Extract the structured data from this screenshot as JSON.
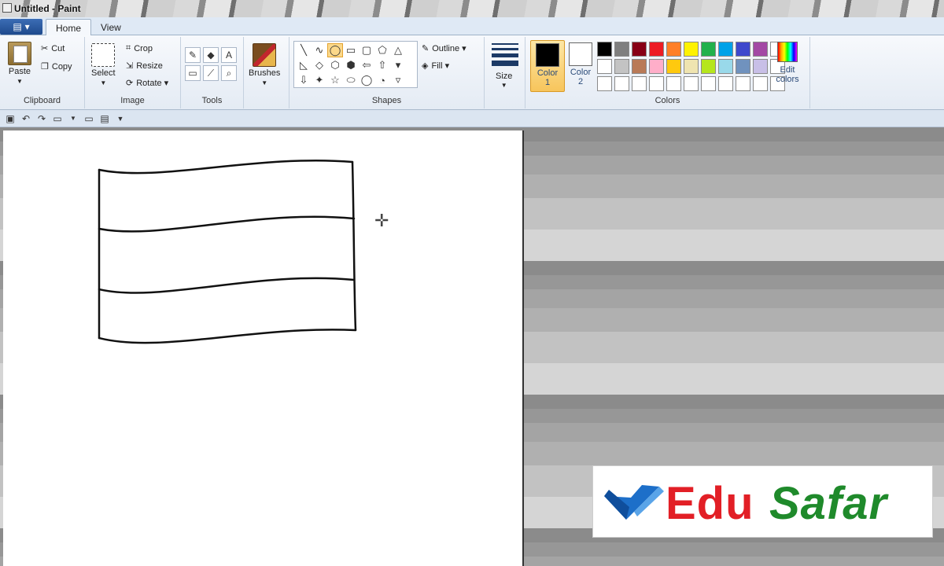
{
  "window": {
    "title": "Untitled - Paint"
  },
  "tabs": {
    "file_label": "▾",
    "home": "Home",
    "view": "View"
  },
  "clipboard": {
    "paste": "Paste",
    "cut": "Cut",
    "copy": "Copy",
    "group": "Clipboard"
  },
  "image": {
    "select": "Select",
    "crop": "Crop",
    "resize": "Resize",
    "rotate": "Rotate ▾",
    "group": "Image"
  },
  "tools": {
    "group": "Tools",
    "items": [
      "✎",
      "◆",
      "A",
      "▭",
      "⟋",
      "⌕"
    ]
  },
  "brushes": {
    "label": "Brushes"
  },
  "shapes": {
    "group": "Shapes",
    "outline": "Outline ▾",
    "fill": "Fill ▾",
    "items": [
      "╲",
      "∿",
      "◯",
      "▭",
      "▢",
      "⬠",
      "△",
      "◺",
      "◇",
      "⬡",
      "⬢",
      "⇦",
      "⇧",
      "▾",
      "⇩",
      "✦",
      "☆",
      "⬭",
      "◯",
      "◔",
      "▿"
    ],
    "selected_index": 2
  },
  "size": {
    "label": "Size"
  },
  "colors": {
    "group": "Colors",
    "color1": {
      "label": "Color",
      "num": "1",
      "value": "#000000"
    },
    "color2": {
      "label": "Color",
      "num": "2",
      "value": "#ffffff"
    },
    "edit": "Edit colors",
    "palette": [
      "#000000",
      "#7f7f7f",
      "#880015",
      "#ed1c24",
      "#ff7f27",
      "#fff200",
      "#22b14c",
      "#00a2e8",
      "#3f48cc",
      "#a349a4",
      "#ffffff",
      "#ffffff",
      "#c3c3c3",
      "#b97a57",
      "#ffaec9",
      "#ffc90e",
      "#efe4b0",
      "#b5e61d",
      "#99d9ea",
      "#7092be",
      "#c8bfe7",
      "#ffffff",
      "#ffffff",
      "#ffffff",
      "#ffffff",
      "#ffffff",
      "#ffffff",
      "#ffffff",
      "#ffffff",
      "#ffffff",
      "#ffffff",
      "#ffffff",
      "#ffffff"
    ]
  },
  "logo": {
    "edu": "Edu",
    "safar": "Safar"
  }
}
